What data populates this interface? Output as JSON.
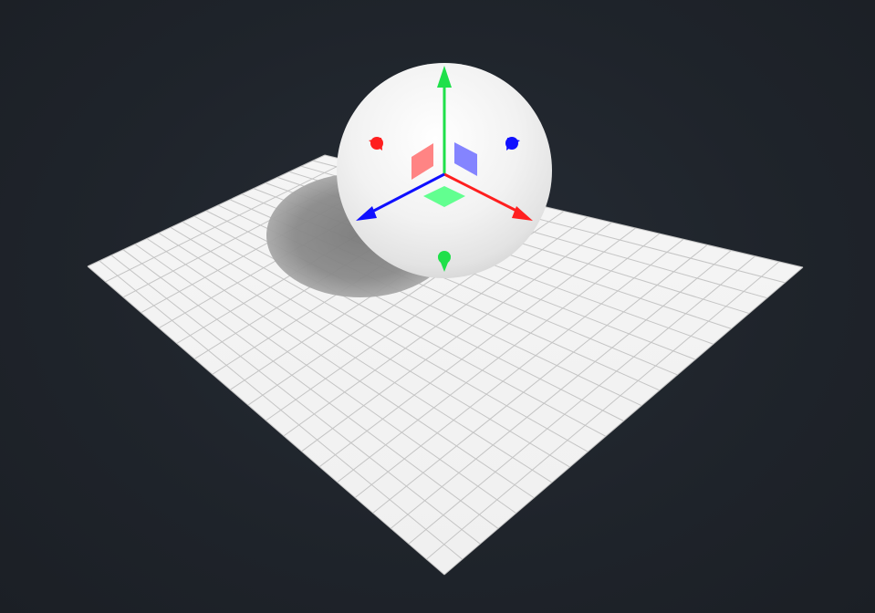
{
  "scene": {
    "background_color": "#22272f",
    "ground": {
      "color": "#f3f3f3",
      "grid_color": "#c4c4c4",
      "grid_divisions": 20
    },
    "sphere": {
      "color": "#f2f2f2",
      "shadow_color": "#7a7a7a"
    },
    "gizmo": {
      "x_axis_color": "#ff1f1f",
      "y_axis_color": "#1fe04a",
      "z_axis_color": "#1010ff",
      "xy_plane_color": "#7d7dff",
      "yz_plane_color": "#ff7d7d",
      "xz_plane_color": "#5aff8a",
      "icons": [
        "translate-x-arrow-icon",
        "translate-y-arrow-icon",
        "translate-z-arrow-icon"
      ]
    }
  }
}
